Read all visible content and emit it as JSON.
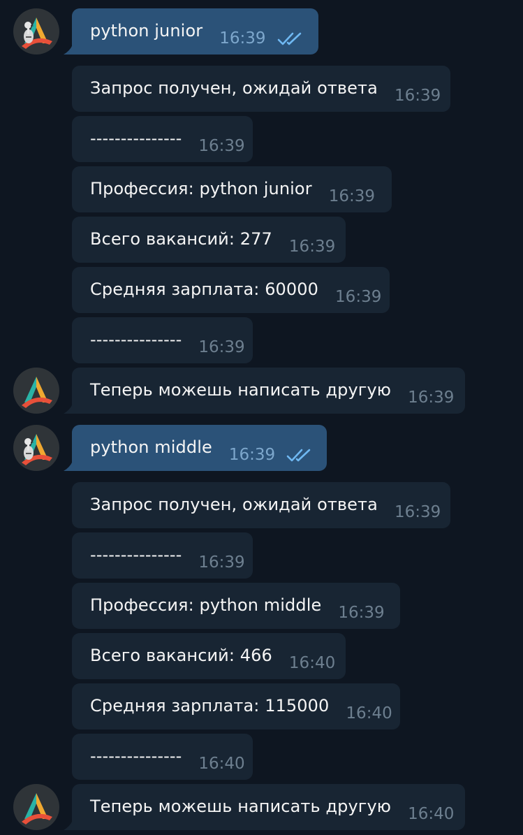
{
  "colors": {
    "background": "#0e1621",
    "incoming_bubble": "#182533",
    "outgoing_bubble": "#2b5278",
    "read_check": "#6fb8f2"
  },
  "messages": [
    {
      "text": "python junior",
      "time": "16:39",
      "direction": "out",
      "status": "read"
    },
    {
      "text": "Запрос получен, ожидай ответа",
      "time": "16:39",
      "direction": "in"
    },
    {
      "text": "---------------",
      "time": "16:39",
      "direction": "in"
    },
    {
      "text": "Профессия: python junior",
      "time": "16:39",
      "direction": "in"
    },
    {
      "text": "Всего вакансий: 277",
      "time": "16:39",
      "direction": "in"
    },
    {
      "text": "Средняя зарплата: 60000",
      "time": "16:39",
      "direction": "in"
    },
    {
      "text": "---------------",
      "time": "16:39",
      "direction": "in"
    },
    {
      "text": "Теперь можешь написать другую",
      "time": "16:39",
      "direction": "in"
    },
    {
      "text": "python middle",
      "time": "16:39",
      "direction": "out",
      "status": "read"
    },
    {
      "text": "Запрос получен, ожидай ответа",
      "time": "16:39",
      "direction": "in"
    },
    {
      "text": "---------------",
      "time": "16:39",
      "direction": "in"
    },
    {
      "text": "Профессия: python middle",
      "time": "16:39",
      "direction": "in"
    },
    {
      "text": "Всего вакансий: 466",
      "time": "16:40",
      "direction": "in"
    },
    {
      "text": "Средняя зарплата: 115000",
      "time": "16:40",
      "direction": "in"
    },
    {
      "text": "---------------",
      "time": "16:40",
      "direction": "in"
    },
    {
      "text": "Теперь можешь написать другую",
      "time": "16:40",
      "direction": "in"
    }
  ]
}
